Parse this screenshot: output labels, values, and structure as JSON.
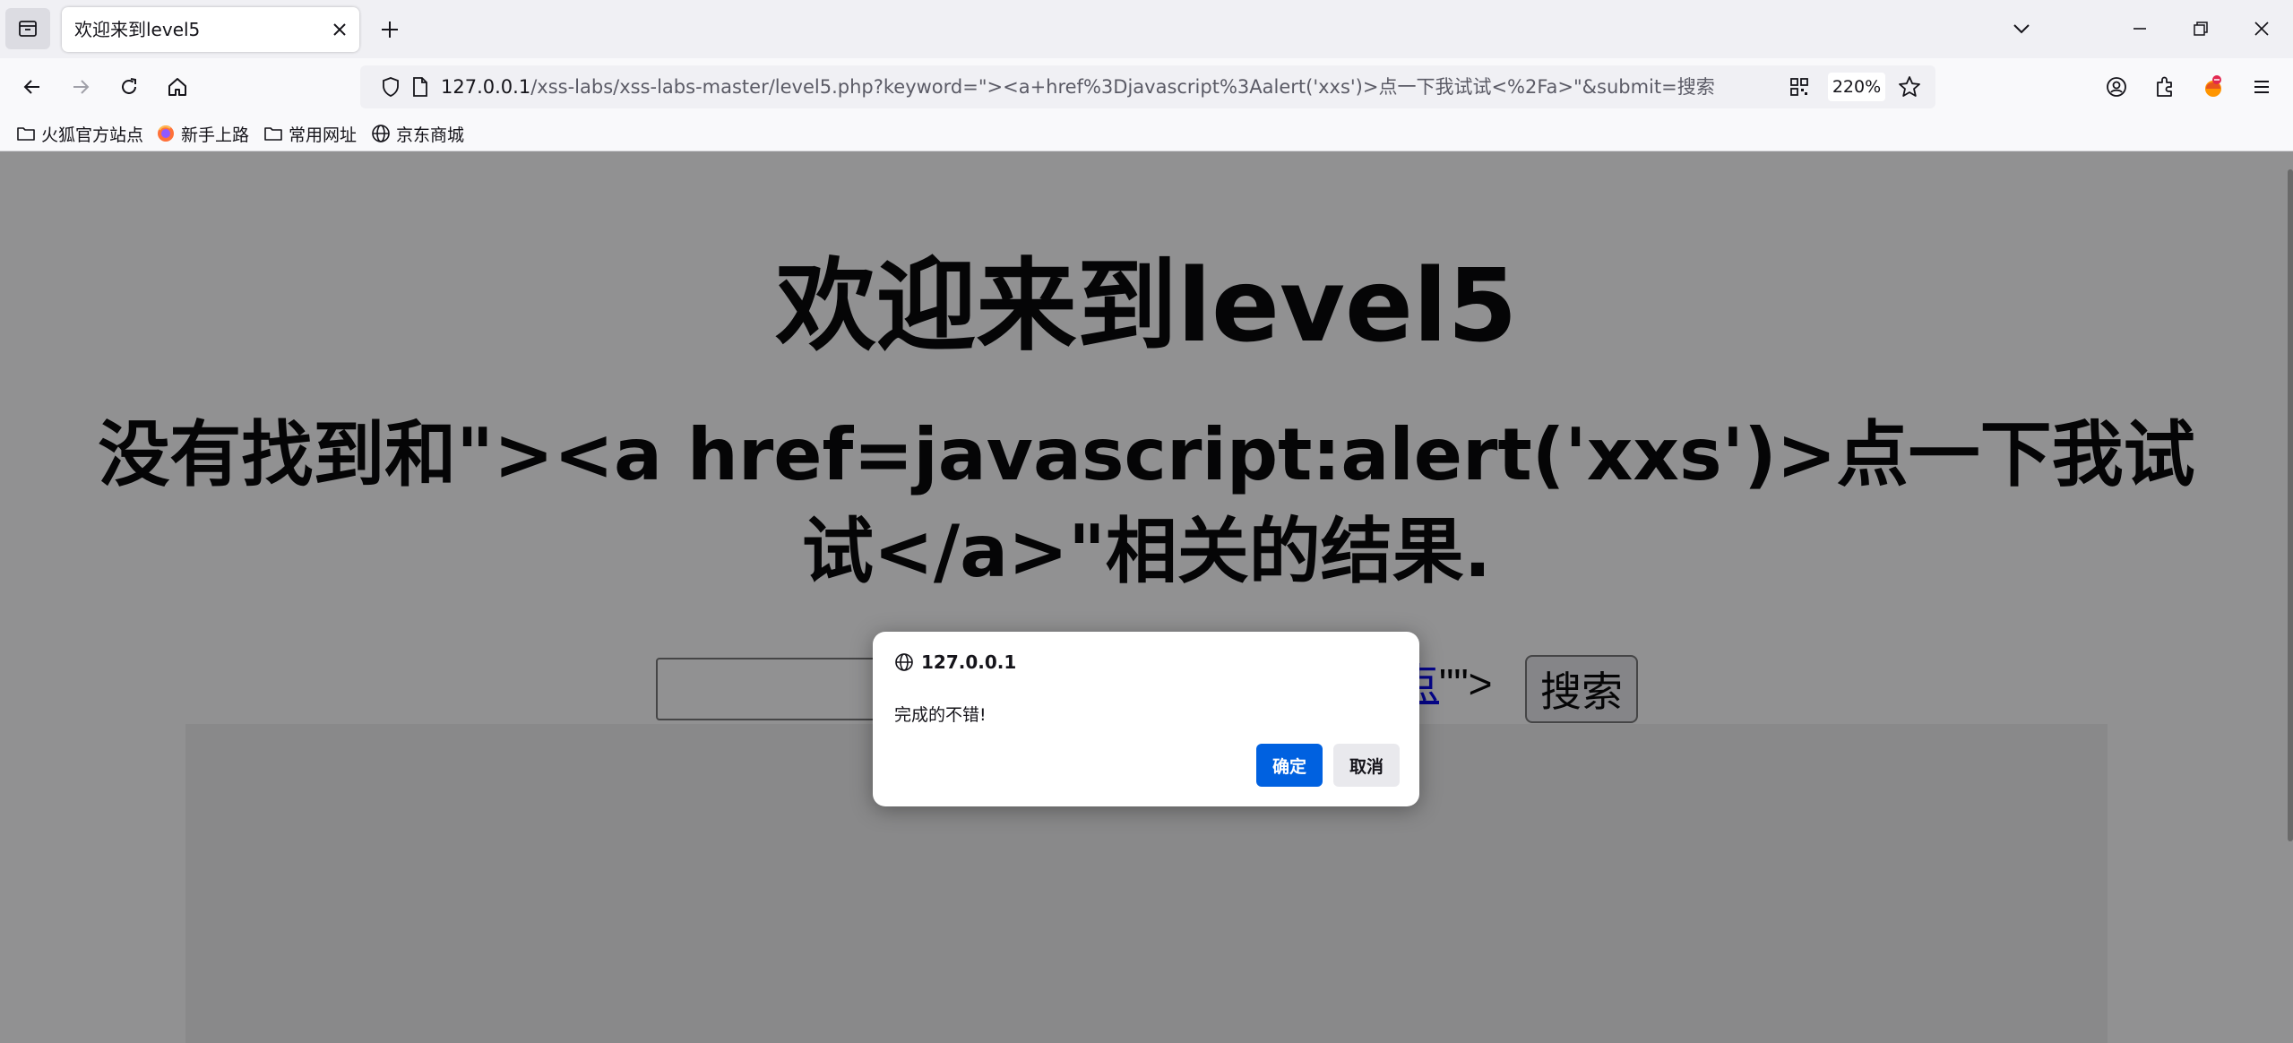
{
  "browser": {
    "tab_title": "欢迎来到level5",
    "url_host": "127.0.0.1",
    "url_rest": "/xss-labs/xss-labs-master/level5.php?keyword=\"><a+href%3Djavascript%3Aalert('xxs')>点一下我试试<%2Fa>\"&submit=搜索",
    "zoom": "220%"
  },
  "bookmarks": [
    {
      "label": "火狐官方站点",
      "icon": "folder-icon"
    },
    {
      "label": "新手上路",
      "icon": "firefox-icon"
    },
    {
      "label": "常用网址",
      "icon": "folder-icon"
    },
    {
      "label": "京东商城",
      "icon": "globe-icon"
    }
  ],
  "page": {
    "heading": "欢迎来到level5",
    "result_text": "没有找到和\"><a href=javascript:alert('xxs')>点一下我试试</a>\"相关的结果.",
    "reflected_link": "点",
    "reflected_tail": "\"\">",
    "search_button": "搜索"
  },
  "dialog": {
    "origin": "127.0.0.1",
    "message": "完成的不错!",
    "ok_label": "确定",
    "cancel_label": "取消"
  },
  "colors": {
    "accent": "#0061e0",
    "link": "#0000ee"
  }
}
